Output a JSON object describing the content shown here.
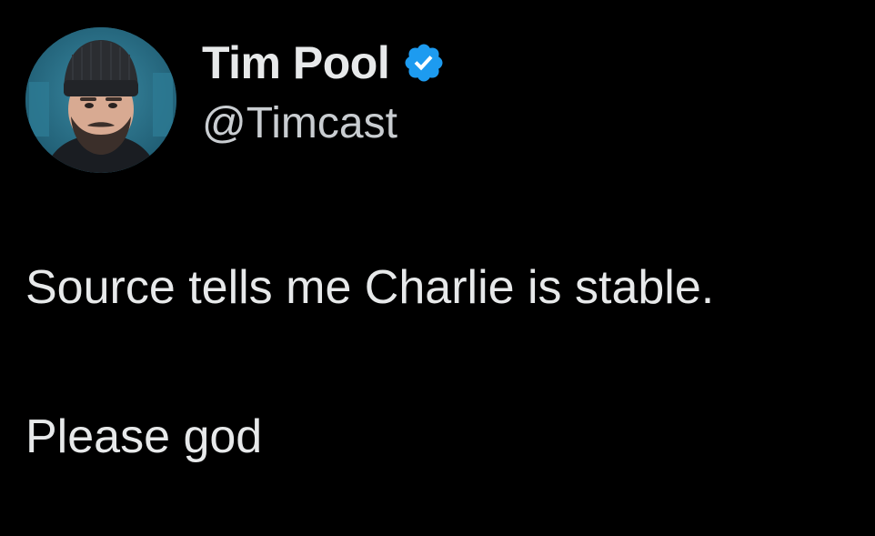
{
  "author": {
    "display_name": "Tim Pool",
    "handle": "@Timcast",
    "verified": true,
    "avatar_icon": "avatar-photo",
    "verified_icon": "verified-badge-icon"
  },
  "tweet": {
    "line1": "Source tells me Charlie is stable.",
    "line2": "Please god"
  },
  "colors": {
    "background": "#000000",
    "text": "#e7e9ea",
    "handle": "#c9cdd1",
    "verified_blue": "#1d9bf0"
  }
}
